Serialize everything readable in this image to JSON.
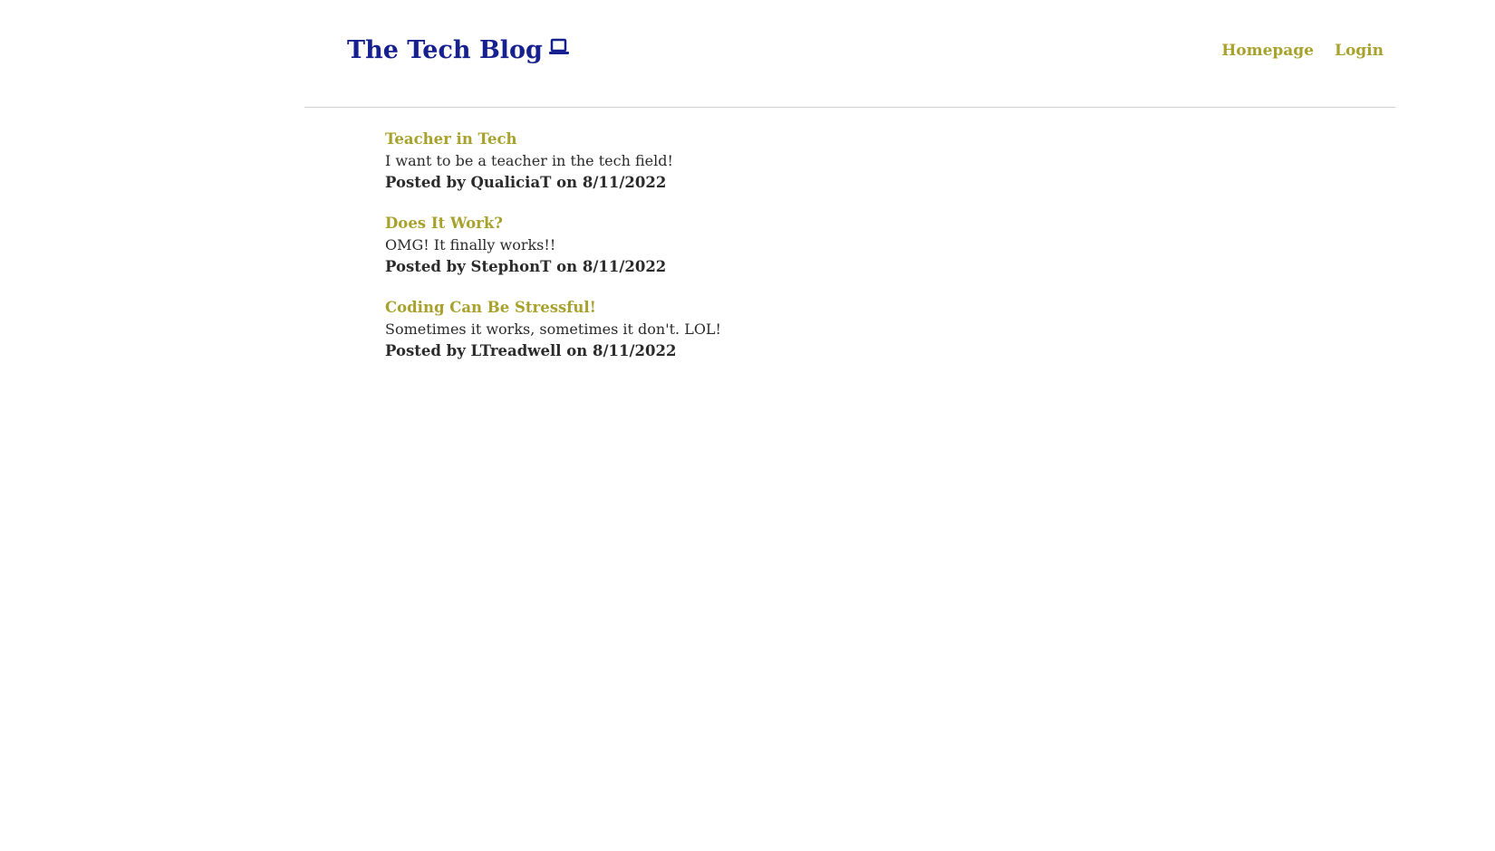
{
  "header": {
    "title": "The Tech Blog",
    "icon": "laptop-icon",
    "nav": [
      {
        "label": "Homepage"
      },
      {
        "label": "Login"
      }
    ]
  },
  "posts": [
    {
      "title": "Teacher in Tech",
      "body": "I want to be a teacher in the tech field!",
      "meta": "Posted by QualiciaT on 8/11/2022"
    },
    {
      "title": "Does It Work?",
      "body": "OMG! It finally works!!",
      "meta": "Posted by StephonT on 8/11/2022"
    },
    {
      "title": "Coding Can Be Stressful!",
      "body": "Sometimes it works, sometimes it don't. LOL!",
      "meta": "Posted by LTreadwell on 8/11/2022"
    }
  ],
  "colors": {
    "brand": "#17208f",
    "accent": "#a8a22c",
    "text": "#2b2b2b",
    "divider": "#cfcfcf"
  }
}
